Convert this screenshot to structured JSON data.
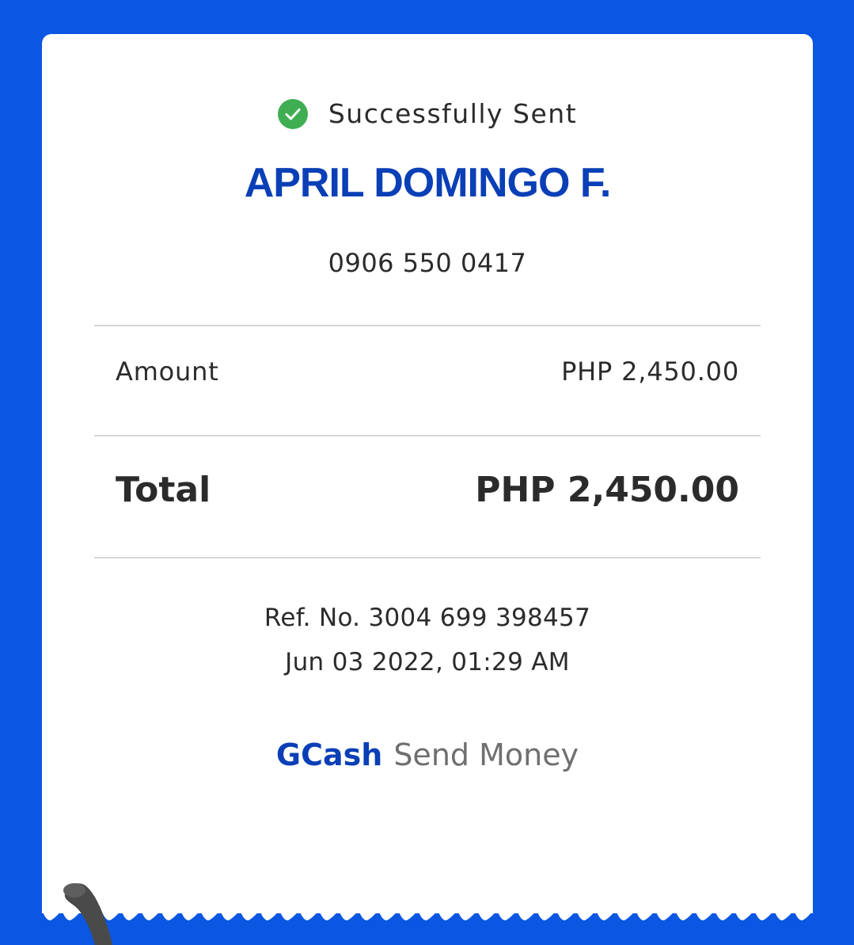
{
  "colors": {
    "background": "#0B57E2",
    "brand_blue": "#0A3FB6",
    "success_green": "#3FAE53"
  },
  "status": {
    "icon": "check-circle-icon",
    "text": "Successfully Sent"
  },
  "recipient": {
    "name": "APRIL DOMINGO F.",
    "number": "0906 550 0417"
  },
  "amount": {
    "label": "Amount",
    "value": "PHP 2,450.00"
  },
  "total": {
    "label": "Total",
    "value": "PHP 2,450.00"
  },
  "reference": {
    "ref_no": "Ref. No. 3004 699 398457",
    "datetime": "Jun 03 2022, 01:29 AM"
  },
  "footer": {
    "brand": "GCash",
    "service": "Send Money"
  }
}
